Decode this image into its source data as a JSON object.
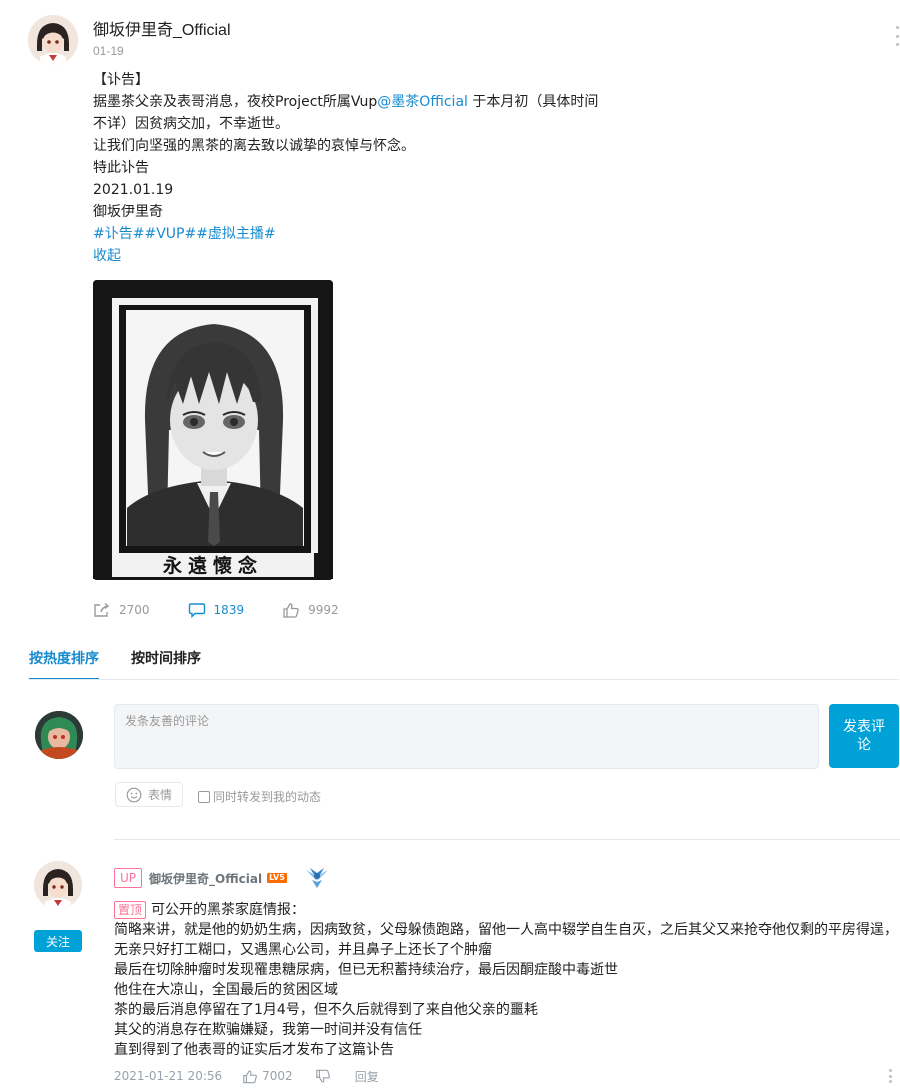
{
  "post": {
    "author_name": "御坂伊里奇_Official",
    "date": "01-19",
    "body_lines": [
      "【讣告】",
      "据墨茶父亲及表哥消息，夜校Project所属Vup",
      "@墨茶Official",
      " 于本月初（具体时间",
      "不详）因贫病交加，不幸逝世。",
      "让我们向坚强的黑茶的离去致以诚挚的哀悼与怀念。",
      "特此讣告",
      "2021.01.19",
      "御坂伊里奇"
    ],
    "hashtags": "#讣告##VUP##虚拟主播#",
    "collapse_label": "收起",
    "image_caption": "永遠懷念",
    "stats": {
      "share_count": "2700",
      "comment_count": "1839",
      "like_count": "9992"
    }
  },
  "sort": {
    "tabs": [
      "按热度排序",
      "按时间排序"
    ],
    "active_index": 0
  },
  "composer": {
    "placeholder": "发条友善的评论",
    "submit_label": "发表评论",
    "emoji_label": "表情",
    "repost_label": "同时转发到我的动态"
  },
  "comment": {
    "up_badge": "UP",
    "author_name": "御坂伊里奇_Official",
    "level": "LV5",
    "pinned_label": "置顶",
    "lines": [
      "可公开的黑茶家庭情报：",
      "简略来讲，就是他的奶奶生病，因病致贫，父母躲债跑路，留他一人高中辍学自生自灭，之后其父又来抢夺他仅剩的平房得逞，",
      "无亲只好打工糊口，又遇黑心公司，并且鼻子上还长了个肿瘤",
      "最后在切除肿瘤时发现罹患糖尿病，但已无积蓄持续治疗，最后因酮症酸中毒逝世",
      "他住在大凉山，全国最后的贫困区域",
      "茶的最后消息停留在了1月4号，但不久后就得到了来自他父亲的噩耗",
      "其父的消息存在欺骗嫌疑，我第一时间并没有信任",
      "直到得到了他表哥的证实后才发布了这篇讣告"
    ],
    "time": "2021-01-21 20:56",
    "like_count": "7002",
    "reply_label": "回复",
    "follow_label": "关注"
  },
  "colors": {
    "accent": "#00a1d6",
    "link": "#178bcf",
    "pink": "#fb7299",
    "level_orange": "#ff6c00"
  }
}
